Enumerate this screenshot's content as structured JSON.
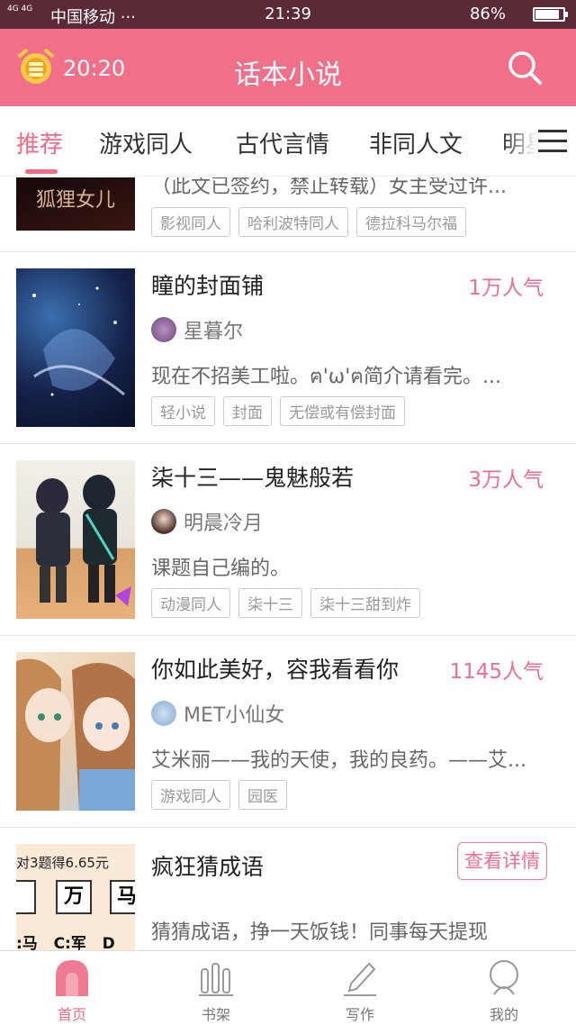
{
  "status_bar": {
    "signal": "4G 4G",
    "carrier": "中国移动 ···",
    "time": "21:39",
    "battery": "86%",
    "battery_level": 0.86
  },
  "header": {
    "timer": "20:20",
    "title": "话本小说",
    "icons": [
      "alarm-clock-icon",
      "search-icon"
    ],
    "color": "#ef7088"
  },
  "tabs": [
    {
      "label": "推荐",
      "active": true
    },
    {
      "label": "游戏同人"
    },
    {
      "label": "古代言情"
    },
    {
      "label": "非同人文"
    },
    {
      "label": "明星"
    }
  ],
  "books": [
    {
      "cover_text": "狐狸女儿",
      "desc": "（此文已签约，禁止转载）女主受过许...",
      "tags": [
        "影视同人",
        "哈利波特同人",
        "德拉科马尔福"
      ]
    },
    {
      "title": "瞳的封面铺",
      "popularity": "1万人气",
      "author": "星暮尔",
      "desc": "现在不招美工啦。ฅ'ω'ฅ简介请看完。...",
      "tags": [
        "轻小说",
        "封面",
        "无偿或有偿封面"
      ]
    },
    {
      "title": "柒十三——鬼魅般若",
      "popularity": "3万人气",
      "author": "明晨冷月",
      "desc": "课题自己编的。",
      "tags": [
        "动漫同人",
        "柒十三",
        "柒十三甜到炸"
      ]
    },
    {
      "title": "你如此美好，容我看看你",
      "popularity": "1145人气",
      "author": "MET小仙女",
      "desc": "艾米丽——我的天使，我的良药。——艾...",
      "tags": [
        "游戏同人",
        "园医"
      ]
    }
  ],
  "ad": {
    "cover_line": "对3题得6.65元",
    "cover_chars": [
      "万",
      "马"
    ],
    "cover_bottom": [
      ":马",
      "C:军",
      "D"
    ],
    "title": "疯狂猜成语",
    "button": "查看详情",
    "desc": "猜猜成语，挣一天饭钱！同事每天提现"
  },
  "bottom_nav": [
    {
      "label": "首页",
      "icon": "home-icon",
      "active": true
    },
    {
      "label": "书架",
      "icon": "bookshelf-icon"
    },
    {
      "label": "写作",
      "icon": "pen-icon"
    },
    {
      "label": "我的",
      "icon": "profile-icon"
    }
  ],
  "colors": {
    "accent": "#ef6b86",
    "status_bar": "#5a2a36"
  }
}
